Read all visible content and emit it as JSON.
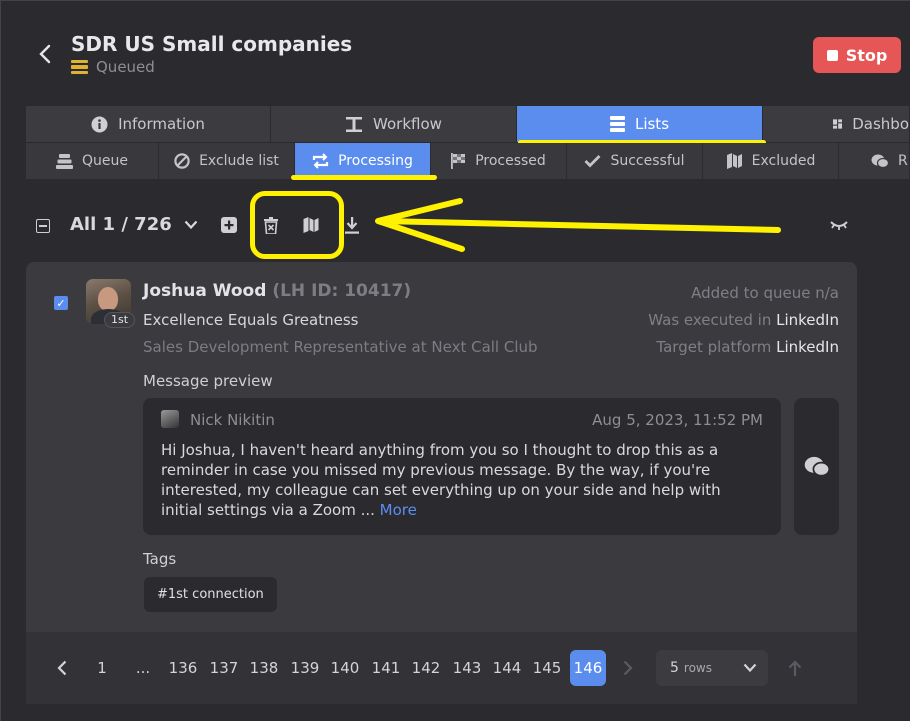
{
  "header": {
    "title": "SDR US Small companies",
    "status": "Queued",
    "stop_label": "Stop"
  },
  "tabs": [
    {
      "label": "Information",
      "icon": "info-icon"
    },
    {
      "label": "Workflow",
      "icon": "workflow-icon"
    },
    {
      "label": "Lists",
      "icon": "lists-icon",
      "active": true
    },
    {
      "label": "Dashbo",
      "icon": "dashboard-icon"
    }
  ],
  "subtabs": [
    {
      "label": "Queue",
      "icon": "queue-icon"
    },
    {
      "label": "Exclude list",
      "icon": "ban-icon"
    },
    {
      "label": "Processing",
      "icon": "processing-icon",
      "active": true
    },
    {
      "label": "Processed",
      "icon": "flag-icon"
    },
    {
      "label": "Successful",
      "icon": "check-icon"
    },
    {
      "label": "Excluded",
      "icon": "excluded-icon"
    },
    {
      "label": "R",
      "icon": "chat-icon"
    }
  ],
  "toolbar": {
    "selection": "All 1 / 726"
  },
  "profile": {
    "name": "Joshua Wood",
    "lh_id": "(LH ID: 10417)",
    "degree": "1st",
    "headline": "Excellence Equals Greatness",
    "job": "Sales Development Representative at Next Call Club",
    "added_label": "Added to queue n/a",
    "executed_label": "Was executed in",
    "executed_value": "LinkedIn",
    "target_label": "Target platform",
    "target_value": "LinkedIn",
    "checked": true
  },
  "message": {
    "section_label": "Message preview",
    "sender": "Nick Nikitin",
    "date": "Aug 5, 2023, 11:52 PM",
    "text": "Hi Joshua, I haven't heard anything from you so I thought to drop this as a reminder in case you missed my previous message.  By the way, if you're interested, my colleague can set everything up on your side and help with initial settings via a Zoom ...",
    "more": "More"
  },
  "tags": {
    "label": "Tags",
    "items": [
      "#1st connection"
    ]
  },
  "pagination": {
    "pages": [
      "1",
      "...",
      "136",
      "137",
      "138",
      "139",
      "140",
      "141",
      "142",
      "143",
      "144",
      "145",
      "146"
    ],
    "current": "146",
    "rows_value": "5",
    "rows_label": "rows"
  },
  "colors": {
    "accent": "#5b8def",
    "stop": "#e65656",
    "annotation": "#fff200",
    "queued": "#e0b232"
  }
}
